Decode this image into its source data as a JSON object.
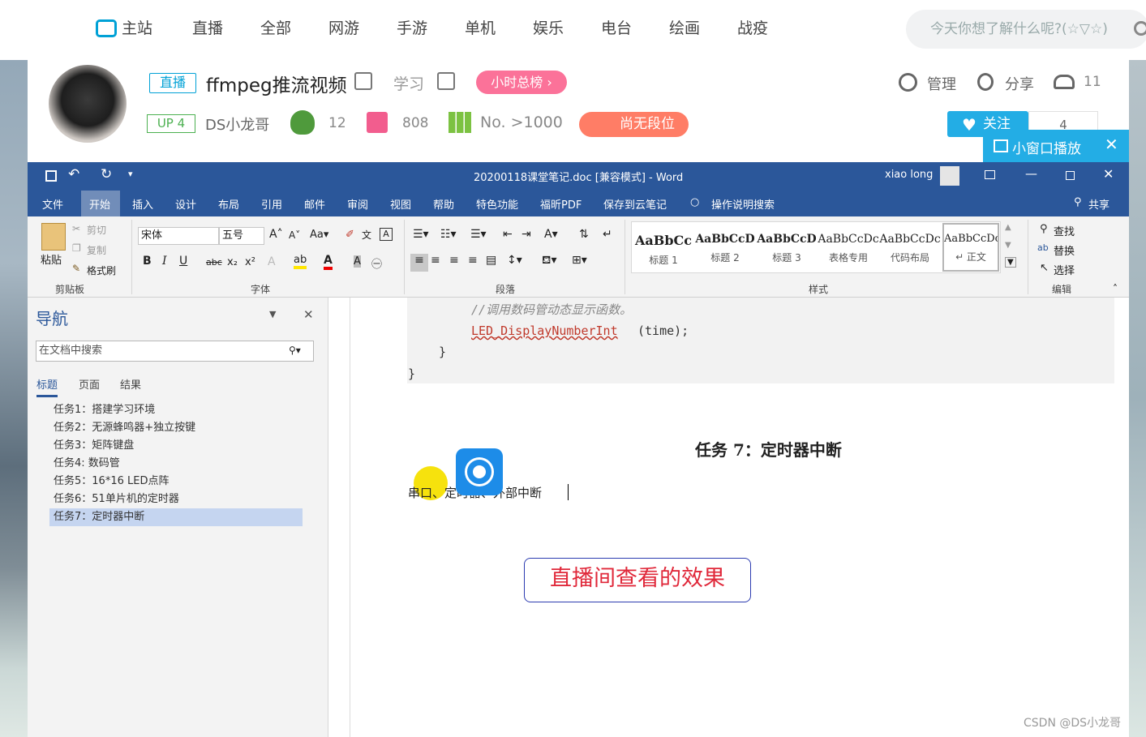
{
  "topnav": {
    "items": [
      "主站",
      "直播",
      "全部",
      "网游",
      "手游",
      "单机",
      "娱乐",
      "电台",
      "绘画",
      "战疫"
    ],
    "search_placeholder": "今天你想了解什么呢?(☆▽☆)"
  },
  "room": {
    "live_badge": "直播",
    "title": "ffmpeg推流视频",
    "category": "学习",
    "rank_badge": "小时总榜",
    "up_level": "UP 4",
    "host_name": "DS小龙哥",
    "count_a": "12",
    "count_b": "808",
    "rank_text": "No. >1000",
    "dan_text": "尚无段位",
    "manage": "管理",
    "share": "分享",
    "viewers": "11",
    "follow_label": "关注",
    "follow_count": "4",
    "pip_label": "小窗口播放"
  },
  "word": {
    "window_title": "20200118课堂笔记.doc [兼容模式] - Word",
    "user_name": "xiao long",
    "tabs": [
      "文件",
      "开始",
      "插入",
      "设计",
      "布局",
      "引用",
      "邮件",
      "审阅",
      "视图",
      "帮助",
      "特色功能",
      "福昕PDF",
      "保存到云笔记",
      "操作说明搜索"
    ],
    "share_label": "共享",
    "clipboard": {
      "paste": "粘贴",
      "cut": "剪切",
      "copy": "复制",
      "format_painter": "格式刷",
      "group": "剪贴板"
    },
    "font": {
      "name": "宋体",
      "size": "五号",
      "group": "字体"
    },
    "paragraph_group": "段落",
    "styles": [
      {
        "sample": "AaBbCc",
        "name": "标题 1"
      },
      {
        "sample": "AaBbCcD",
        "name": "标题 2"
      },
      {
        "sample": "AaBbCcD",
        "name": "标题 3"
      },
      {
        "sample": "AaBbCcDc",
        "name": "表格专用"
      },
      {
        "sample": "AaBbCcDc",
        "name": "代码布局"
      },
      {
        "sample": "AaBbCcDc",
        "name": "↵ 正文"
      }
    ],
    "styles_group": "样式",
    "editing": {
      "find": "查找",
      "replace": "替换",
      "select": "选择",
      "group": "编辑"
    }
  },
  "nav_pane": {
    "title": "导航",
    "search_placeholder": "在文档中搜索",
    "tabs": [
      "标题",
      "页面",
      "结果"
    ],
    "headings": [
      "任务1：搭建学习环境",
      "任务2：无源蜂鸣器+独立按键",
      "任务3：矩阵键盘",
      "任务4: 数码管",
      "任务5：16*16 LED点阵",
      "任务6：51单片机的定时器",
      "任务7：定时器中断"
    ],
    "selected_index": 6
  },
  "document": {
    "comment_line": "//调用数码管动态显示函数。",
    "call_func": "LED_DisplayNumberInt",
    "call_args": "(time);",
    "brace1": "}",
    "brace2": "}",
    "heading": "任务 7：定时器中断",
    "body_line": "串口、定时器、外部中断",
    "annotation": "直播间查看的效果"
  },
  "watermark": "CSDN @DS小龙哥"
}
